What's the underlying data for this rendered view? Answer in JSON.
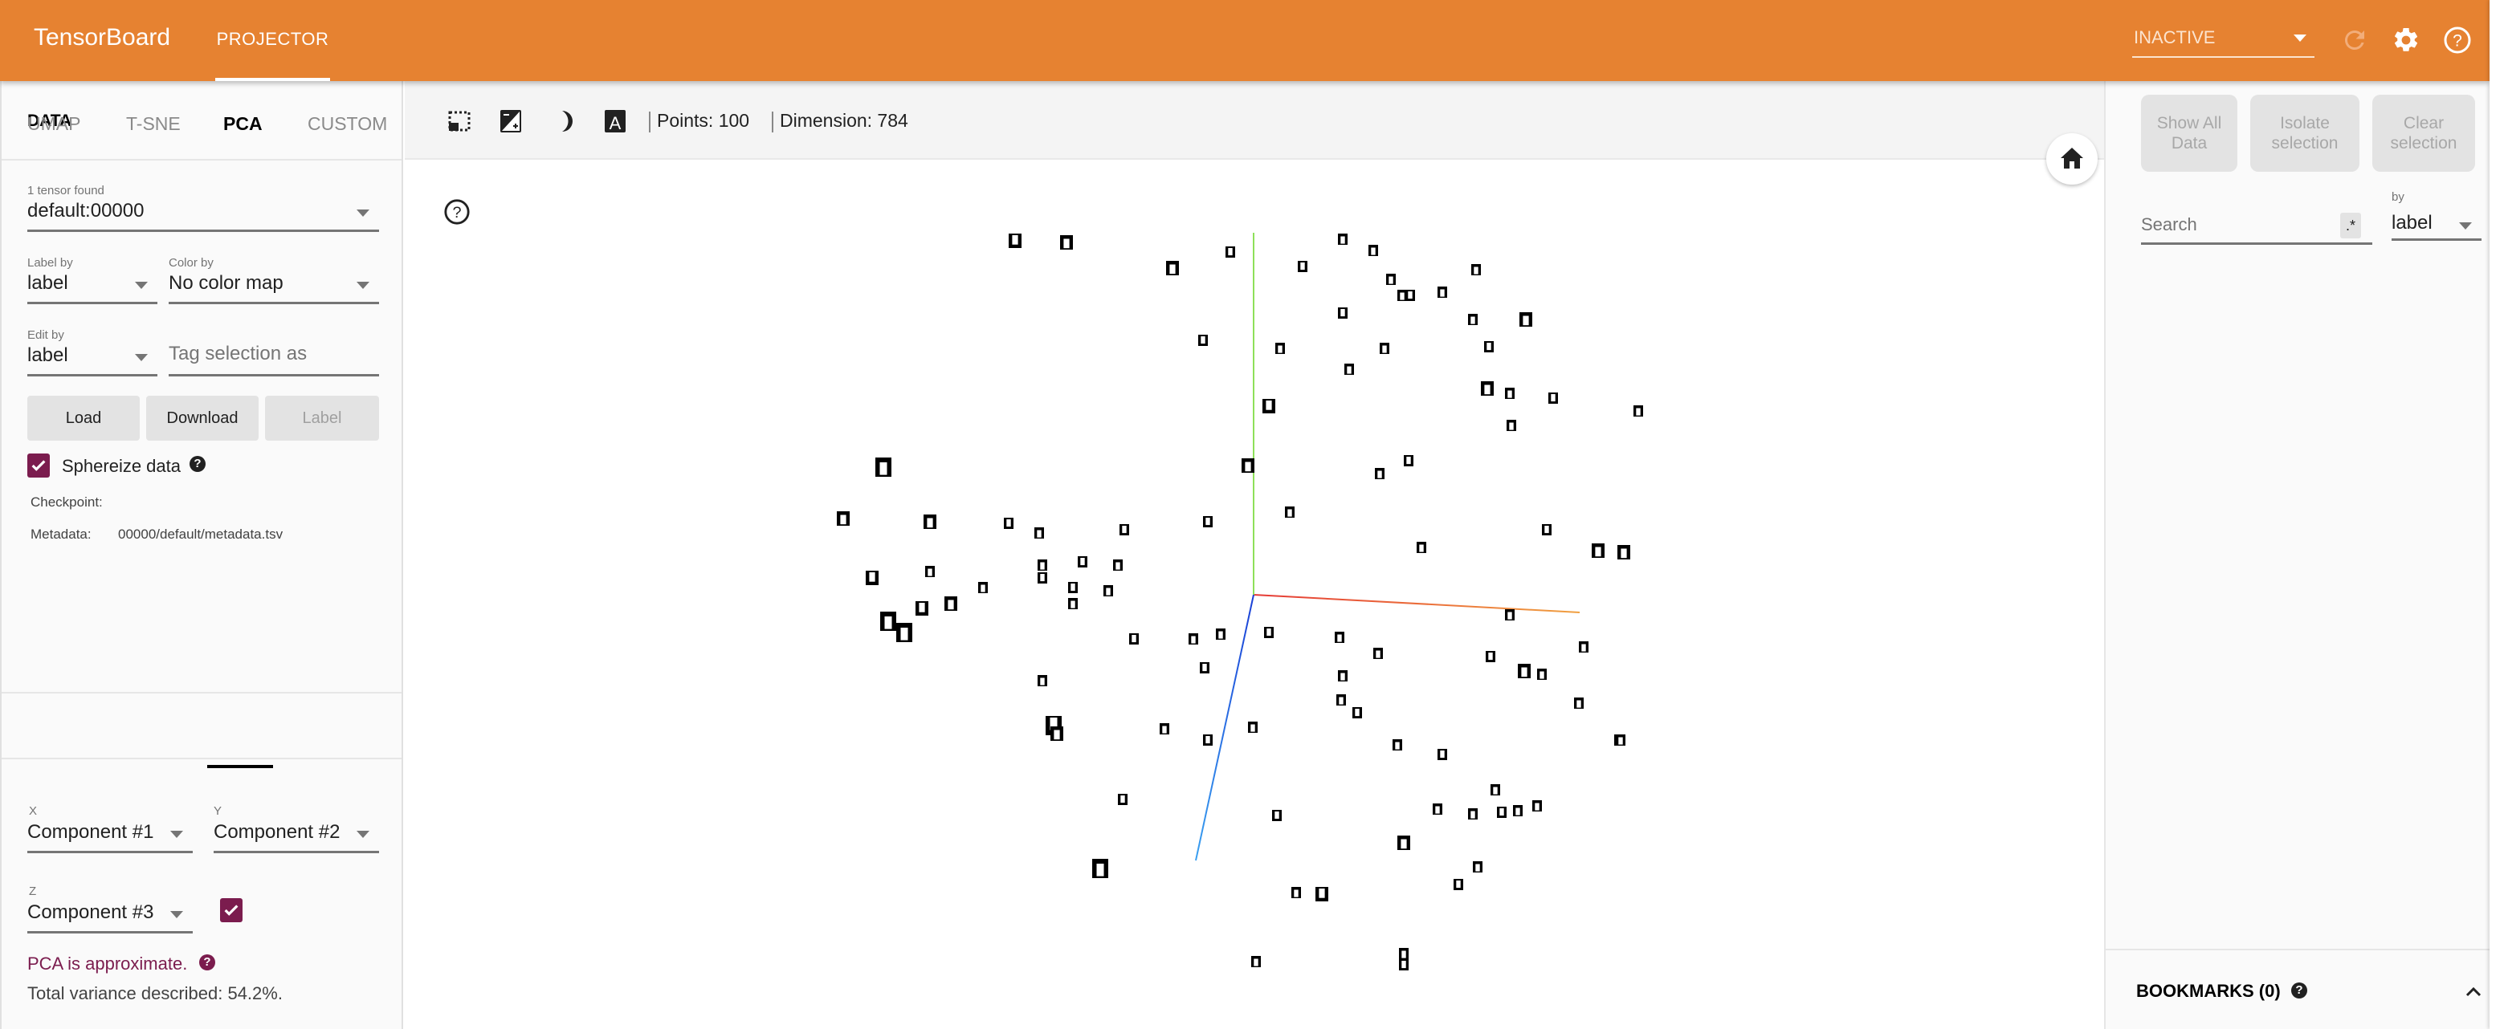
{
  "header": {
    "brand": "TensorBoard",
    "tabs": [
      {
        "label": "PROJECTOR",
        "active": true
      }
    ],
    "run_selector": {
      "value": "INACTIVE"
    },
    "icons": [
      "refresh-icon",
      "settings-icon",
      "help-icon"
    ]
  },
  "data_panel": {
    "title": "DATA",
    "tensor": {
      "label": "1 tensor found",
      "value": "default:00000"
    },
    "label_by": {
      "label": "Label by",
      "value": "label"
    },
    "color_by": {
      "label": "Color by",
      "value": "No color map"
    },
    "edit_by": {
      "label": "Edit by",
      "value": "label"
    },
    "tag_selection": {
      "placeholder": "Tag selection as",
      "value": ""
    },
    "buttons": {
      "load": "Load",
      "download": "Download",
      "label": "Label"
    },
    "sphereize": {
      "label": "Sphereize data",
      "checked": true
    },
    "checkpoint": {
      "label": "Checkpoint:",
      "value": ""
    },
    "metadata": {
      "label": "Metadata:",
      "value": "00000/default/metadata.tsv"
    }
  },
  "projections": {
    "tabs": [
      {
        "label": "UMAP",
        "active": false
      },
      {
        "label": "T-SNE",
        "active": false
      },
      {
        "label": "PCA",
        "active": true
      },
      {
        "label": "CUSTOM",
        "active": false
      }
    ],
    "pca": {
      "x": {
        "label": "X",
        "value": "Component #1"
      },
      "y": {
        "label": "Y",
        "value": "Component #2"
      },
      "z": {
        "label": "Z",
        "value": "Component #3"
      },
      "z_enabled": true,
      "approx_note": "PCA is approximate.",
      "variance": "Total variance described: 54.2%."
    }
  },
  "toolbar": {
    "points_label": "Points: 100",
    "dimension_label": "Dimension: 784",
    "icons": [
      "select-region-icon",
      "night-mode-contrast-icon",
      "dark-mode-icon",
      "label-mode-icon"
    ]
  },
  "scene": {
    "axis_colors": {
      "x_start": "#e53935",
      "x_end": "#f0a040",
      "y": "#8ee05a",
      "z_start": "#1a3fd6",
      "z_end": "#3aa0f0"
    },
    "point_count": 100
  },
  "inspector": {
    "buttons": {
      "show_all": "Show All Data",
      "isolate": "Isolate selection",
      "clear": "Clear selection"
    },
    "search": {
      "placeholder": "Search",
      "value": "",
      "regex_label": ".*"
    },
    "by": {
      "label": "by",
      "value": "label"
    },
    "bookmarks": {
      "title": "BOOKMARKS (0)"
    }
  },
  "colors": {
    "header": "#e68231",
    "accent": "#7b1c4e"
  }
}
